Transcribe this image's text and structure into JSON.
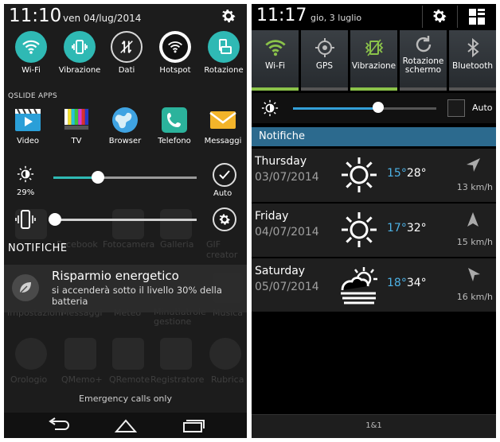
{
  "left_screen": {
    "status": {
      "time": "11:10",
      "date": "ven 04/lug/2014"
    },
    "toggles": [
      {
        "label": "Wi-Fi",
        "icon": "wifi-icon",
        "state": "on"
      },
      {
        "label": "Vibrazione",
        "icon": "vibrate-icon",
        "state": "on"
      },
      {
        "label": "Dati",
        "icon": "data-icon",
        "state": "off"
      },
      {
        "label": "Hotspot",
        "icon": "hotspot-icon",
        "state": "off"
      },
      {
        "label": "Rotazione",
        "icon": "rotation-icon",
        "state": "on"
      }
    ],
    "qslide_header": "QSLIDE APPS",
    "qslide_apps": [
      {
        "label": "Video",
        "icon": "video-icon"
      },
      {
        "label": "TV",
        "icon": "tv-icon"
      },
      {
        "label": "Browser",
        "icon": "browser-globe-icon"
      },
      {
        "label": "Telefono",
        "icon": "phone-icon"
      },
      {
        "label": "Messaggi",
        "icon": "messages-icon"
      }
    ],
    "brightness": {
      "percent_label": "29%",
      "level": 0.29,
      "auto_label": "Auto"
    },
    "volume": {
      "level": 0.0
    },
    "notifications_header": "NOTIFICHE",
    "notification": {
      "title": "Risparmio energetico",
      "body": "si accenderà sotto il livello 30% della batteria"
    },
    "background_apps": [
      "Facebook",
      "Fotocamera",
      "Galleria",
      "GIF creator",
      "Impostazioni",
      "Messaggi",
      "Meteo",
      "Minutiatrole gestione",
      "Musica",
      "Orologio",
      "QMemo+",
      "QRemote",
      "Registratore",
      "Rubrica"
    ],
    "emergency": "Emergency calls only",
    "accent": "#2fb9b4"
  },
  "right_screen": {
    "status": {
      "time": "11:17",
      "date": "gio, 3 luglio"
    },
    "toggles": [
      {
        "label": "Wi-Fi",
        "icon": "wifi-icon",
        "state": "on"
      },
      {
        "label": "GPS",
        "icon": "gps-icon",
        "state": "off"
      },
      {
        "label": "Vibrazione",
        "icon": "vibrate-icon",
        "state": "on"
      },
      {
        "label": "Rotazione schermo",
        "icon": "rotation-icon",
        "state": "off"
      },
      {
        "label": "Bluetooth",
        "icon": "bluetooth-icon",
        "state": "off"
      }
    ],
    "brightness": {
      "level": 0.6,
      "auto_label": "Auto"
    },
    "notifications_header": "Notifiche",
    "weather": [
      {
        "day": "Thursday",
        "date": "03/07/2014",
        "icon": "sun-icon",
        "low": "15°",
        "high": "28°",
        "wind": "13 km/h",
        "wind_dir": "wind-arrow-northeast-icon"
      },
      {
        "day": "Friday",
        "date": "04/07/2014",
        "icon": "sun-icon",
        "low": "17°",
        "high": "32°",
        "wind": "15 km/h",
        "wind_dir": "wind-arrow-north-icon"
      },
      {
        "day": "Saturday",
        "date": "05/07/2014",
        "icon": "sun-cloud-fog-icon",
        "low": "18°",
        "high": "34°",
        "wind": "16 km/h",
        "wind_dir": "wind-arrow-northwest-icon"
      }
    ],
    "carrier": "1&1",
    "accent": "#8bc34a",
    "header_color": "#2c6a8e"
  }
}
